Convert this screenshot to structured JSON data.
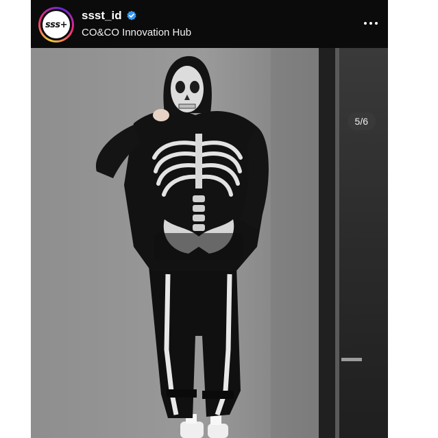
{
  "post": {
    "username": "ssst_id",
    "location": "CO&CO Innovation Hub",
    "avatar_text": "sss+",
    "verified": true,
    "verified_color": "#3897f0",
    "carousel_counter": "5/6",
    "more_icon": "more-options-icon"
  },
  "photo": {
    "description_icon": "photo-skeleton-outfit",
    "wall_color": "#8d8d8d",
    "door_color": "#2a2a2a"
  }
}
